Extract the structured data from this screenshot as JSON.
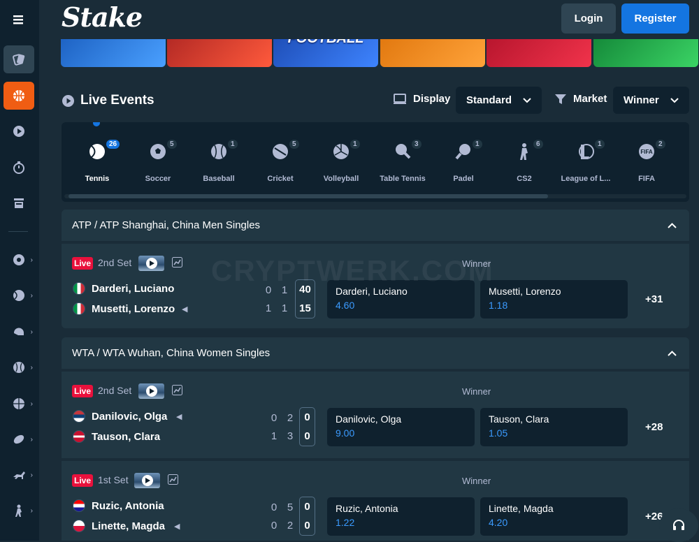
{
  "header": {
    "logo": "Stake",
    "login": "Login",
    "register": "Register"
  },
  "banners": [
    {
      "caption": "",
      "color": "#1e63c4"
    },
    {
      "caption": "",
      "color": "#d93a2a"
    },
    {
      "caption": "FOOTBALL",
      "color": "#2b63d6"
    },
    {
      "caption": "",
      "color": "#f08a1a"
    },
    {
      "caption": "",
      "color": "#d81f35"
    },
    {
      "caption": "",
      "color": "#22b14c"
    }
  ],
  "live": {
    "title": "Live Events",
    "display_label": "Display",
    "display_value": "Standard",
    "market_label": "Market",
    "market_value": "Winner"
  },
  "sports": [
    {
      "name": "Tennis",
      "count": "26",
      "icon": "tennis-ball-icon"
    },
    {
      "name": "Soccer",
      "count": "5",
      "icon": "soccer-ball-icon"
    },
    {
      "name": "Baseball",
      "count": "1",
      "icon": "baseball-icon"
    },
    {
      "name": "Cricket",
      "count": "5",
      "icon": "cricket-ball-icon"
    },
    {
      "name": "Volleyball",
      "count": "1",
      "icon": "volleyball-icon"
    },
    {
      "name": "Table Tennis",
      "count": "3",
      "icon": "table-tennis-icon"
    },
    {
      "name": "Padel",
      "count": "1",
      "icon": "padel-icon"
    },
    {
      "name": "CS2",
      "count": "6",
      "icon": "cs2-soldier-icon"
    },
    {
      "name": "League of L...",
      "count": "1",
      "icon": "league-of-legends-icon"
    },
    {
      "name": "FIFA",
      "count": "2",
      "icon": "fifa-icon"
    }
  ],
  "sections": [
    {
      "title": "ATP / ATP Shanghai, China Men Singles"
    },
    {
      "title": "WTA / WTA Wuhan, China Women Singles"
    }
  ],
  "matches": [
    {
      "badge": "Live",
      "set": "2nd Set",
      "market": "Winner",
      "more": "+31",
      "p1": {
        "name": "Darderi, Luciano",
        "s1": "0",
        "s2": "1",
        "cur": "40"
      },
      "p2": {
        "name": "Musetti, Lorenzo",
        "s1": "1",
        "s2": "1",
        "cur": "15"
      },
      "o1": {
        "name": "Darderi, Luciano",
        "odd": "4.60"
      },
      "o2": {
        "name": "Musetti, Lorenzo",
        "odd": "1.18"
      }
    },
    {
      "badge": "Live",
      "set": "2nd Set",
      "market": "Winner",
      "more": "+28",
      "p1": {
        "name": "Danilovic, Olga",
        "s1": "0",
        "s2": "2",
        "cur": "0"
      },
      "p2": {
        "name": "Tauson, Clara",
        "s1": "1",
        "s2": "3",
        "cur": "0"
      },
      "o1": {
        "name": "Danilovic, Olga",
        "odd": "9.00"
      },
      "o2": {
        "name": "Tauson, Clara",
        "odd": "1.05"
      }
    },
    {
      "badge": "Live",
      "set": "1st Set",
      "market": "Winner",
      "more": "+26",
      "p1": {
        "name": "Ruzic, Antonia",
        "s1": "0",
        "s2": "5",
        "cur": "0"
      },
      "p2": {
        "name": "Linette, Magda",
        "s1": "0",
        "s2": "2",
        "cur": "0"
      },
      "o1": {
        "name": "Ruzic, Antonia",
        "odd": "1.22"
      },
      "o2": {
        "name": "Linette, Magda",
        "odd": "4.20"
      }
    }
  ],
  "watermark": "CRYPTWERK.COM",
  "colors": {
    "bg": "#1a2c38",
    "panel": "#213743",
    "dark": "#0f212e",
    "accent": "#1475e1",
    "live": "#e9113c",
    "odds": "#3b9bff",
    "sports_active": "#f05d13"
  }
}
